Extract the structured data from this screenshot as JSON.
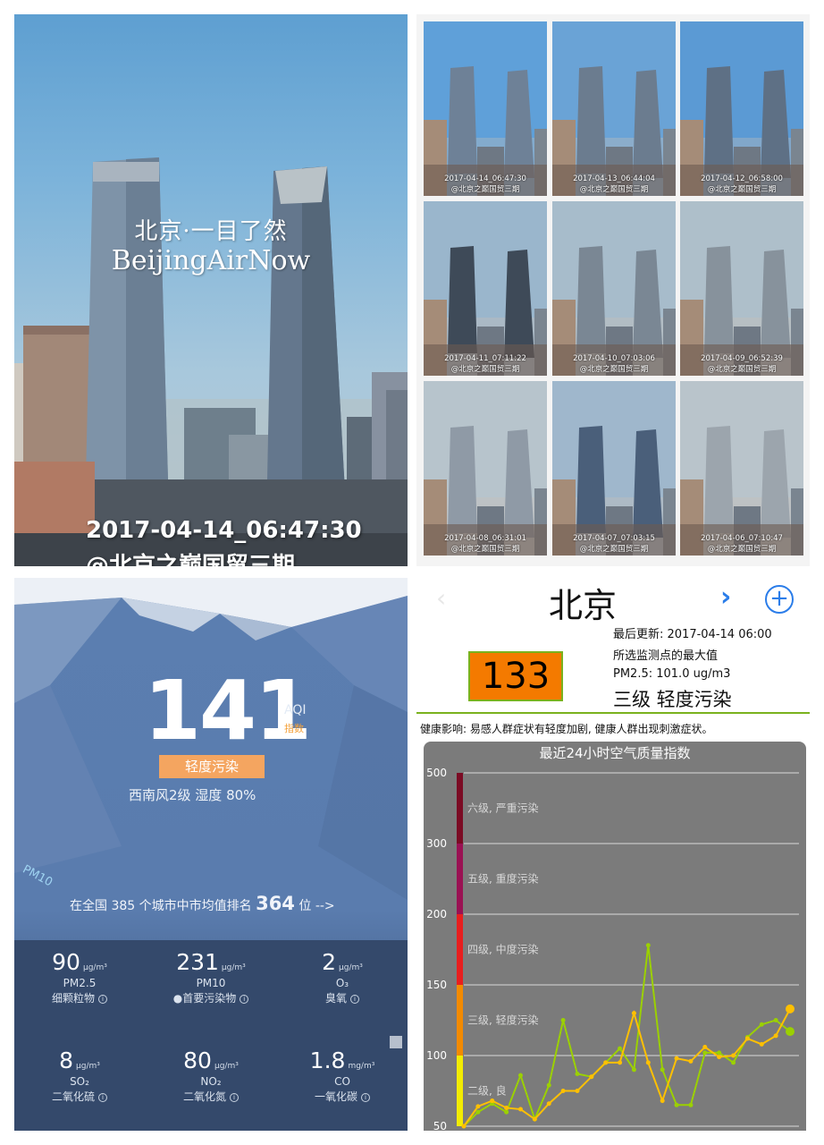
{
  "photo_main": {
    "title_cn": "北京·一目了然",
    "title_en": "BeijingAirNow",
    "timestamp": "2017-04-14_06:47:30",
    "credit": "@北京之巅国贸三期"
  },
  "photo_grid": [
    {
      "timestamp": "2017-04-14_06:47:30",
      "credit": "@北京之巅国贸三期"
    },
    {
      "timestamp": "2017-04-13_06:44:04",
      "credit": "@北京之巅国贸三期"
    },
    {
      "timestamp": "2017-04-12_06:58:00",
      "credit": "@北京之巅国贸三期"
    },
    {
      "timestamp": "2017-04-11_07:11:22",
      "credit": "@北京之巅国贸三期"
    },
    {
      "timestamp": "2017-04-10_07:03:06",
      "credit": "@北京之巅国贸三期"
    },
    {
      "timestamp": "2017-04-09_06:52:39",
      "credit": "@北京之巅国贸三期"
    },
    {
      "timestamp": "2017-04-08_06:31:01",
      "credit": "@北京之巅国贸三期"
    },
    {
      "timestamp": "2017-04-07_07:03:15",
      "credit": "@北京之巅国贸三期"
    },
    {
      "timestamp": "2017-04-06_07:10:47",
      "credit": "@北京之巅国贸三期"
    }
  ],
  "aqi_app": {
    "aqi": "141",
    "aqi_label": "AQI",
    "aqi_sub": "指数",
    "level": "轻度污染",
    "weather": "西南风2级   湿度 80%",
    "pm10_tag": "PM10",
    "ranking_prefix": "在全国 385 个城市中市均值排名",
    "ranking_value": "364",
    "ranking_suffix": "位 -->",
    "pollutants": [
      {
        "value": "90",
        "unit": "μg/m³",
        "name": "PM2.5",
        "desc": "细颗粒物"
      },
      {
        "value": "231",
        "unit": "μg/m³",
        "name": "PM10",
        "desc": "●首要污染物"
      },
      {
        "value": "2",
        "unit": "μg/m³",
        "name": "O₃",
        "desc": "臭氧"
      },
      {
        "value": "8",
        "unit": "μg/m³",
        "name": "SO₂",
        "desc": "二氧化硫"
      },
      {
        "value": "80",
        "unit": "μg/m³",
        "name": "NO₂",
        "desc": "二氧化氮"
      },
      {
        "value": "1.8",
        "unit": "mg/m³",
        "name": "CO",
        "desc": "一氧化碳"
      }
    ]
  },
  "city_page": {
    "city": "北京",
    "aqi": "133",
    "last_update": "最后更新: 2017-04-14 06:00",
    "max_value_note": "所选监测点的最大值",
    "pm25": "PM2.5: 101.0 ug/m3",
    "level": "三级 轻度污染",
    "health": "健康影响: 易感人群症状有轻度加剧, 健康人群出现刺激症状。",
    "colors": {
      "aqi_box": "#f47a00",
      "accent_blue": "#2b7de9",
      "green_rule": "#7ab21e"
    }
  },
  "chart_data": {
    "type": "line",
    "title": "最近24小时空气质量指数",
    "y_ticks": [
      50,
      100,
      150,
      200,
      300,
      500
    ],
    "bands": [
      {
        "label": "二级, 良",
        "from": 50,
        "to": 100,
        "color": "#f2ec00"
      },
      {
        "label": "三级, 轻度污染",
        "from": 100,
        "to": 150,
        "color": "#f28a00"
      },
      {
        "label": "四级, 中度污染",
        "from": 150,
        "to": 200,
        "color": "#e81e1e"
      },
      {
        "label": "五级, 重度污染",
        "from": 200,
        "to": 300,
        "color": "#9a1153"
      },
      {
        "label": "六级, 严重污染",
        "from": 300,
        "to": 500,
        "color": "#7b0b24"
      }
    ],
    "series": [
      {
        "name": "",
        "color": "#9bd000",
        "values": [
          50,
          60,
          66,
          60,
          86,
          55,
          79,
          125,
          87,
          85,
          95,
          105,
          90,
          178,
          90,
          65,
          65,
          102,
          102,
          95,
          113,
          122,
          125,
          117
        ]
      },
      {
        "name": "",
        "color": "#ffc000",
        "values": [
          50,
          64,
          68,
          63,
          62,
          55,
          66,
          75,
          75,
          85,
          95,
          95,
          130,
          95,
          68,
          98,
          96,
          106,
          99,
          100,
          112,
          108,
          114,
          133
        ]
      }
    ]
  }
}
